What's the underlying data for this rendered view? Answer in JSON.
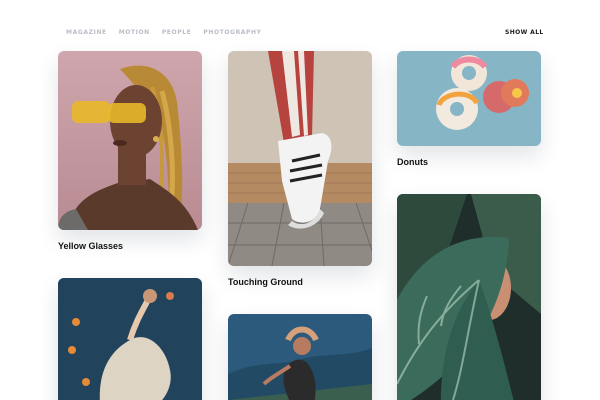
{
  "nav": {
    "filters": [
      "MAGAZINE",
      "MOTION",
      "PEOPLE",
      "PHOTOGRAPHY"
    ],
    "show_all": "SHOW ALL"
  },
  "cards": [
    {
      "title": "Yellow Glasses"
    },
    {
      "title": "Touching Ground"
    },
    {
      "title": "Donuts"
    },
    {
      "title": ""
    },
    {
      "title": ""
    },
    {
      "title": ""
    }
  ]
}
